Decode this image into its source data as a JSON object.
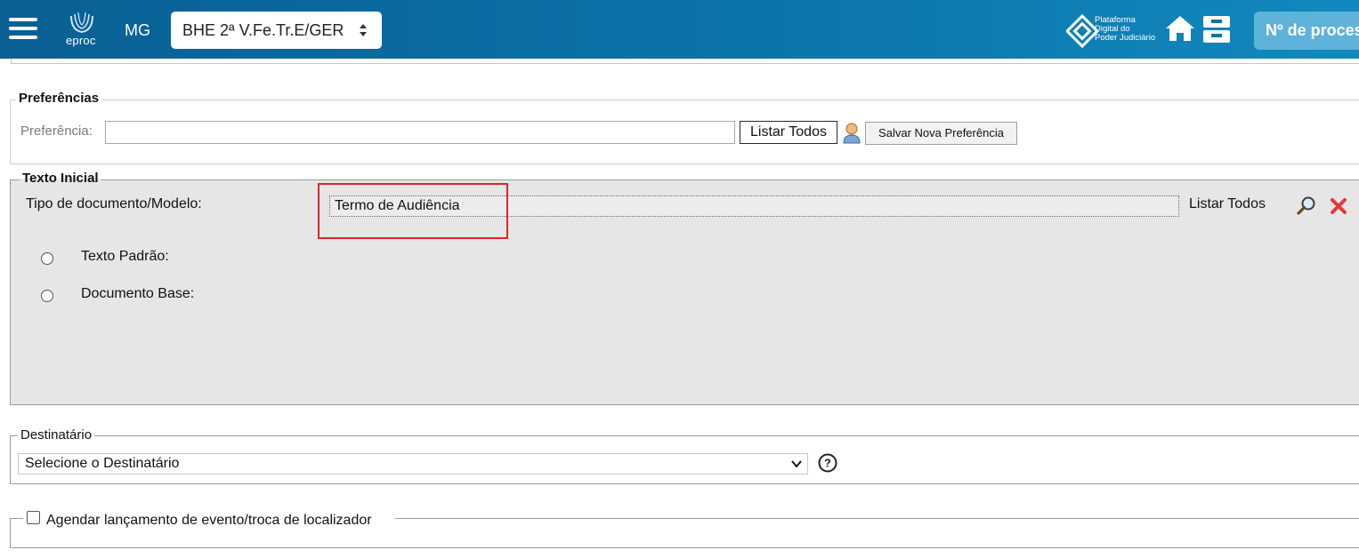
{
  "header": {
    "logo_text": "eproc",
    "state": "MG",
    "org_unit": "BHE 2ª V.Fe.Tr.E/GER",
    "platform_lines": [
      "Plataforma",
      "Digital do",
      "Poder Judiciário"
    ],
    "process_search_placeholder": "Nº de proces",
    "bar_color": "#0b74a9"
  },
  "preferencias": {
    "legend": "Preferências",
    "label": "Preferência:",
    "value": "",
    "list_all_button": "Listar Todos",
    "save_button": "Salvar Nova Preferência"
  },
  "texto_inicial": {
    "legend": "Texto Inicial",
    "tipo_label": "Tipo de documento/Modelo:",
    "tipo_value": "Termo de Audiência",
    "list_all_link": "Listar Todos",
    "options": [
      {
        "label": "Texto Padrão:",
        "checked": false
      },
      {
        "label": "Documento Base:",
        "checked": false
      }
    ],
    "highlight_color": "#e32228"
  },
  "destinatario": {
    "legend": "Destinatário",
    "selected": "Selecione o Destinatário"
  },
  "agendar": {
    "label": "Agendar lançamento de evento/troca de localizador",
    "checked": false
  }
}
